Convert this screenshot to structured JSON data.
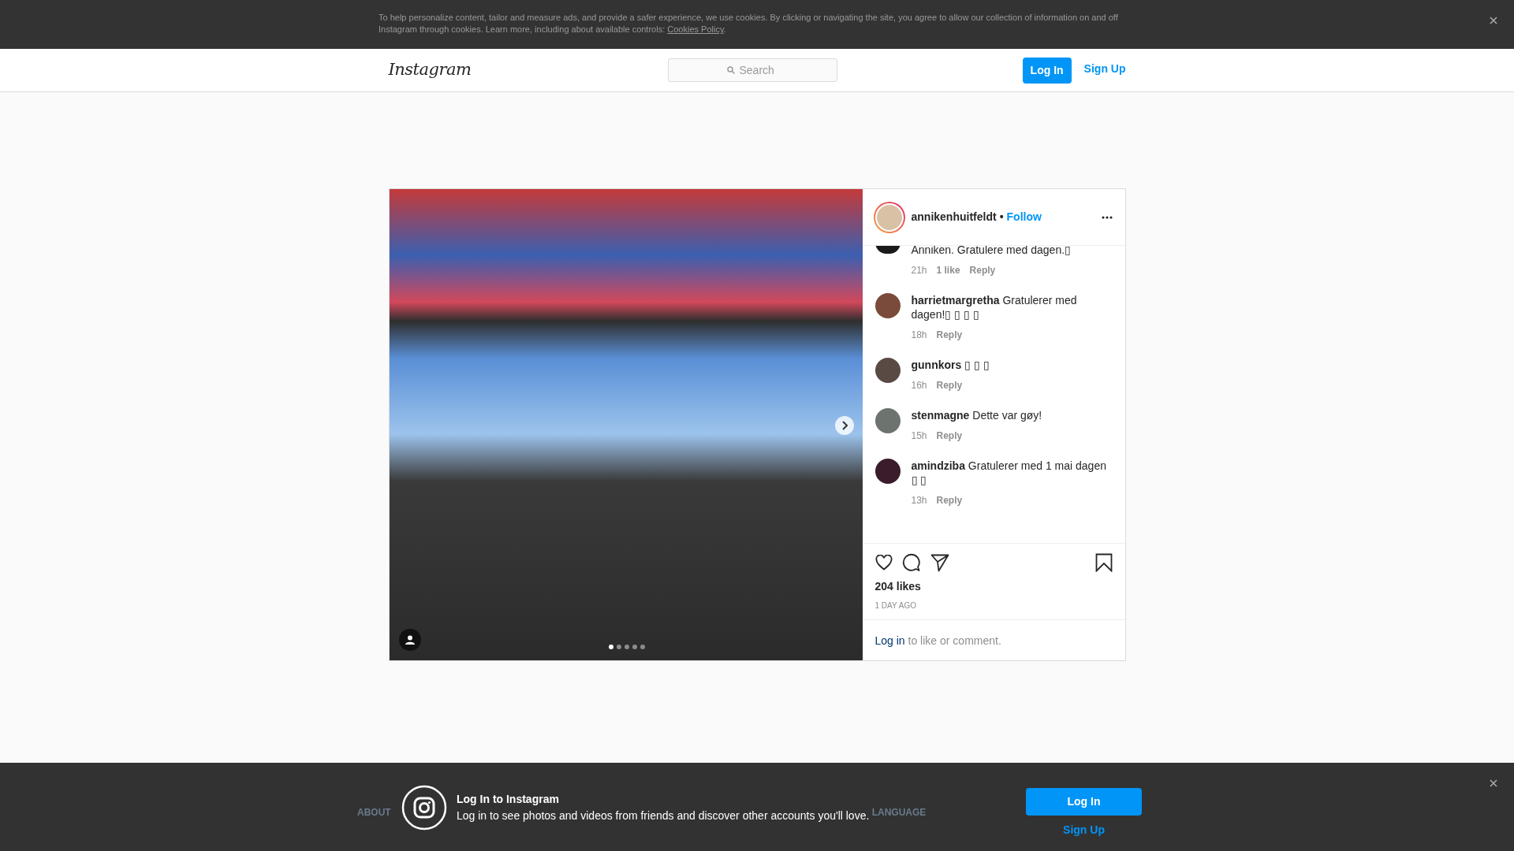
{
  "cookie_banner": {
    "text": "To help personalize content, tailor and measure ads, and provide a safer experience, we use cookies. By clicking or navigating the site, you agree to allow our collection of information on and off Instagram through cookies. Learn more, including about available controls: ",
    "link": "Cookies Policy",
    "suffix": "."
  },
  "header": {
    "logo": "Instagram",
    "search": {
      "placeholder": "Search"
    },
    "login": "Log In",
    "signup": "Sign Up"
  },
  "post": {
    "slides": [
      {
        "selected": true
      },
      {
        "selected": false
      },
      {
        "selected": false
      },
      {
        "selected": false
      },
      {
        "selected": false
      }
    ],
    "author": {
      "username": "annikenhuitfeldt",
      "separator": "•",
      "follow": "Follow"
    },
    "comments": [
      {
        "text": "Anniken. Gratulere med dagen.▯",
        "time": "21h",
        "likes": "1 like",
        "reply": "Reply"
      },
      {
        "username": "harrietmargretha",
        "text": "Gratulerer med dagen!▯ ▯ ▯ ▯",
        "time": "18h",
        "reply": "Reply"
      },
      {
        "username": "gunnkors",
        "text": "▯ ▯ ▯",
        "time": "16h",
        "reply": "Reply"
      },
      {
        "username": "stenmagne",
        "text": "Dette var gøy!",
        "time": "15h",
        "reply": "Reply"
      },
      {
        "username": "amindziba",
        "text": "Gratulerer med 1 mai dagen ▯ ▯",
        "time": "13h",
        "reply": "Reply"
      }
    ],
    "likes": "204 likes",
    "time": "1 DAY AGO",
    "login_prompt": {
      "link": "Log in",
      "text": "to like or comment."
    }
  },
  "footer": {
    "links": [
      "ABOUT",
      "LANGUAGE"
    ]
  },
  "login_banner": {
    "title": "Log In to Instagram",
    "text": "Log in to see photos and videos from friends and discover other accounts you'll love.",
    "login": "Log In",
    "signup": "Sign Up"
  }
}
